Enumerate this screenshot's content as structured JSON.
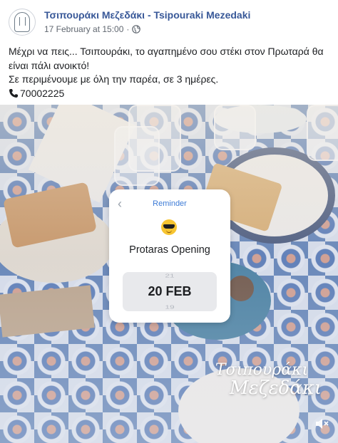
{
  "post": {
    "page_name": "Τσιπουράκι Μεζεδάκι - Tsipouraki Mezedaki",
    "timestamp": "17 February at 15:00",
    "separator": "·",
    "privacy_icon": "globe-icon",
    "text_line1": "Μέχρι να πεις... Τσιπουράκι, το αγαπημένο σου στέκι στον Πρωταρά θα είναι πάλι ανοικτό!",
    "text_line2": "Σε περιμένουμε με όλη την παρέα, σε 3 ημέρες.",
    "phone_icon": "phone-icon",
    "phone": "70002225"
  },
  "reminder": {
    "title": "Reminder",
    "emoji": "sunglasses-emoji",
    "event": "Protaras Opening",
    "date_prev": "21",
    "date_current": "20 FEB",
    "date_next": "19"
  },
  "watermark": {
    "line1": "Τσιπουράκι",
    "line2": "Μεζεδάκι"
  },
  "media": {
    "mute_icon": "speaker-muted-icon"
  },
  "colors": {
    "page_link": "#385898",
    "reminder_accent": "#3d7bd6"
  }
}
